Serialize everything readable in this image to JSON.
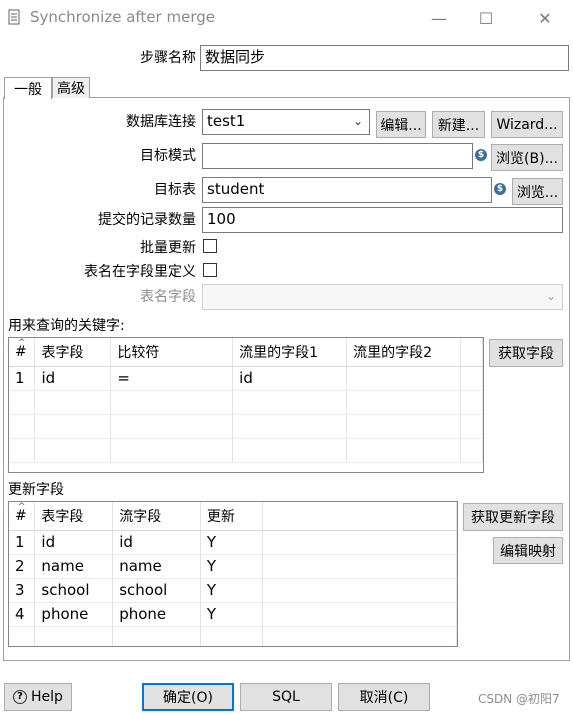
{
  "window": {
    "title": "Synchronize after merge",
    "minimize": "—",
    "maximize": "☐",
    "close": "✕"
  },
  "step": {
    "label": "步骤名称",
    "value": "数据同步"
  },
  "tabs": [
    {
      "label": "一般"
    },
    {
      "label": "高级"
    }
  ],
  "general": {
    "db_label": "数据库连接",
    "db_value": "test1",
    "edit_btn": "编辑...",
    "new_btn": "新建...",
    "wizard_btn": "Wizard...",
    "schema_label": "目标模式",
    "schema_value": "",
    "browse_b_btn": "浏览(B)...",
    "table_label": "目标表",
    "table_value": "student",
    "browse_btn": "浏览...",
    "commit_label": "提交的记录数量",
    "commit_value": "100",
    "batch_label": "批量更新",
    "tablename_in_field_label": "表名在字段里定义",
    "tablename_field_label": "表名字段",
    "variable_icon": "$"
  },
  "keys": {
    "title": "用来查询的关键字:",
    "get_fields_btn": "获取字段",
    "columns": [
      "#",
      "表字段",
      "比较符",
      "流里的字段1",
      "流里的字段2"
    ],
    "rows": [
      [
        "1",
        "id",
        "=",
        "id",
        ""
      ]
    ]
  },
  "update": {
    "title": "更新字段",
    "get_update_btn": "获取更新字段",
    "edit_mapping_btn": "编辑映射",
    "columns": [
      "#",
      "表字段",
      "流字段",
      "更新"
    ],
    "rows": [
      [
        "1",
        "id",
        "id",
        "Y"
      ],
      [
        "2",
        "name",
        "name",
        "Y"
      ],
      [
        "3",
        "school",
        "school",
        "Y"
      ],
      [
        "4",
        "phone",
        "phone",
        "Y"
      ]
    ]
  },
  "footer": {
    "help": "Help",
    "ok": "确定(O)",
    "sql": "SQL",
    "cancel": "取消(C)"
  },
  "watermark": "CSDN @初阳7"
}
